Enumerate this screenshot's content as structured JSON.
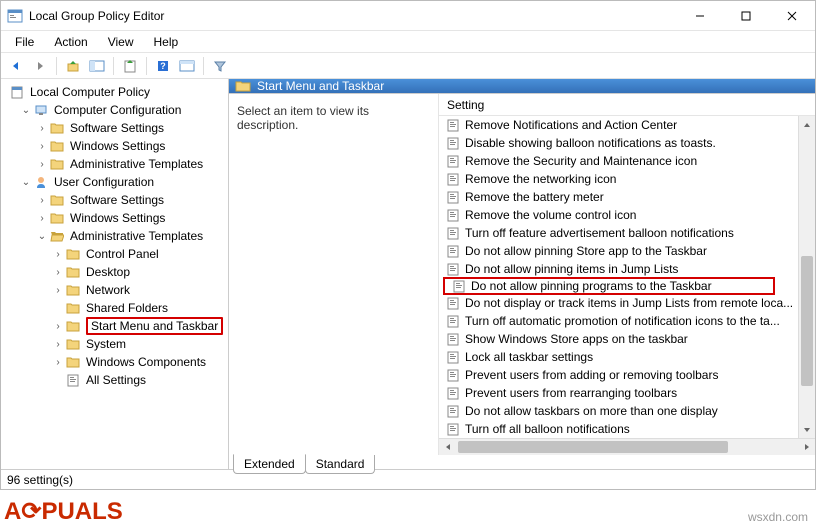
{
  "window": {
    "title": "Local Group Policy Editor"
  },
  "menu": [
    "File",
    "Action",
    "View",
    "Help"
  ],
  "tree": {
    "root": "Local Computer Policy",
    "cc": "Computer Configuration",
    "cc_ss": "Software Settings",
    "cc_ws": "Windows Settings",
    "cc_at": "Administrative Templates",
    "uc": "User Configuration",
    "uc_ss": "Software Settings",
    "uc_ws": "Windows Settings",
    "uc_at": "Administrative Templates",
    "cp": "Control Panel",
    "dt": "Desktop",
    "nw": "Network",
    "sf": "Shared Folders",
    "smt": "Start Menu and Taskbar",
    "sys": "System",
    "wc": "Windows Components",
    "all": "All Settings"
  },
  "content": {
    "header": "Start Menu and Taskbar",
    "desc": "Select an item to view its description.",
    "colhead": "Setting"
  },
  "settings": [
    "Remove Notifications and Action Center",
    "Disable showing balloon notifications as toasts.",
    "Remove the Security and Maintenance icon",
    "Remove the networking icon",
    "Remove the battery meter",
    "Remove the volume control icon",
    "Turn off feature advertisement balloon notifications",
    "Do not allow pinning Store app to the Taskbar",
    "Do not allow pinning items in Jump Lists",
    "Do not allow pinning programs to the Taskbar",
    "Do not display or track items in Jump Lists from remote loca...",
    "Turn off automatic promotion of notification icons to the ta...",
    "Show Windows Store apps on the taskbar",
    "Lock all taskbar settings",
    "Prevent users from adding or removing toolbars",
    "Prevent users from rearranging toolbars",
    "Do not allow taskbars on more than one display",
    "Turn off all balloon notifications"
  ],
  "tabs": {
    "ext": "Extended",
    "std": "Standard"
  },
  "status": "96 setting(s)",
  "watermark": "wsxdn.com",
  "highlight_setting_index": 9
}
